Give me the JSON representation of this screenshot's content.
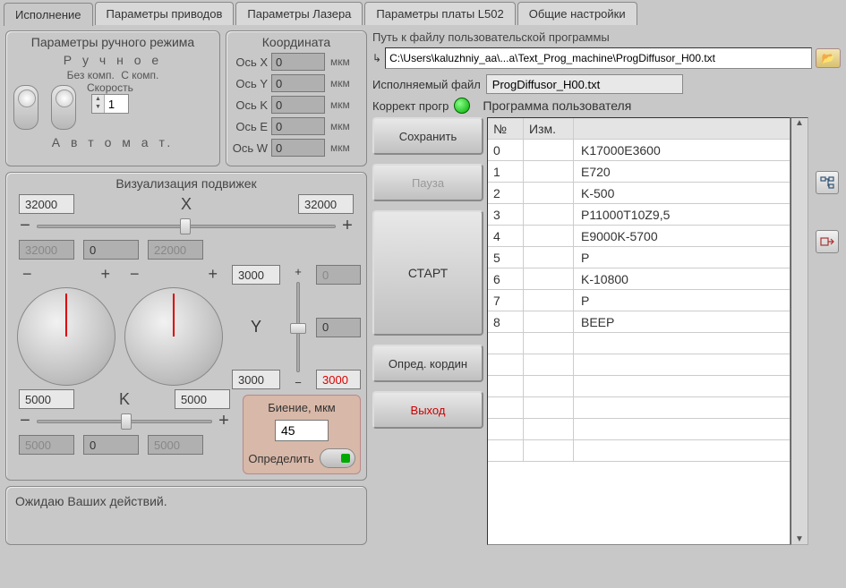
{
  "tabs": [
    "Исполнение",
    "Параметры приводов",
    "Параметры Лазера",
    "Параметры платы L502",
    "Общие настройки"
  ],
  "activeTab": 0,
  "manual": {
    "title": "Параметры ручного режима",
    "mode_manual": "Р у ч н о е",
    "no_comp": "Без комп.",
    "with_comp": "С комп.",
    "speed_label": "Скорость",
    "speed_value": "1",
    "mode_auto": "А в т о м а т."
  },
  "coord": {
    "title": "Координата",
    "unit": "мкм",
    "axes": [
      {
        "label": "Ось X",
        "value": "0"
      },
      {
        "label": "Ось Y",
        "value": "0"
      },
      {
        "label": "Ось K",
        "value": "0"
      },
      {
        "label": "Ось E",
        "value": "0"
      },
      {
        "label": "Ось W",
        "value": "0"
      }
    ]
  },
  "viz": {
    "title": "Визуализация подвижек",
    "X": {
      "name": "X",
      "top_left": "32000",
      "top_right": "32000",
      "bot_left": "32000",
      "bot_center": "0",
      "bot_right": "22000"
    },
    "Y": {
      "name": "Y",
      "top": "3000",
      "top_disabled": "0",
      "mid_disabled": "0",
      "bot": "3000",
      "bot_red": "3000"
    },
    "K": {
      "name": "K",
      "top_left": "5000",
      "top_right": "5000",
      "bot_left": "5000",
      "bot_center": "0",
      "bot_right": "5000"
    },
    "runout": {
      "title": "Биение, мкм",
      "value": "45",
      "determine": "Определить"
    }
  },
  "status": "Ожидаю Ваших действий.",
  "right": {
    "path_label": "Путь к файлу пользовательской программы",
    "path_value": "C:\\Users\\kaluzhniy_aa\\...a\\Text_Prog_machine\\ProgDiffusor_H00.txt",
    "exec_label": "Исполняемый файл",
    "exec_value": "ProgDiffusor_H00.txt",
    "correct_label": "Коррект прогр",
    "prog_label": "Программа пользователя",
    "buttons": {
      "save": "Сохранить",
      "pause": "Пауза",
      "start": "СТАРТ",
      "coord": "Опред. кордин",
      "exit": "Выход"
    },
    "table": {
      "headers": {
        "idx": "№",
        "izm": "Изм."
      },
      "rows": [
        {
          "idx": "0",
          "cmd": "K17000E3600"
        },
        {
          "idx": "1",
          "cmd": "E720"
        },
        {
          "idx": "2",
          "cmd": "K-500"
        },
        {
          "idx": "3",
          "cmd": "P11000T10Z9,5"
        },
        {
          "idx": "4",
          "cmd": "E9000K-5700"
        },
        {
          "idx": "5",
          "cmd": "P"
        },
        {
          "idx": "6",
          "cmd": "K-10800"
        },
        {
          "idx": "7",
          "cmd": "P"
        },
        {
          "idx": "8",
          "cmd": "BEEP"
        }
      ],
      "blank_rows": 6
    }
  }
}
